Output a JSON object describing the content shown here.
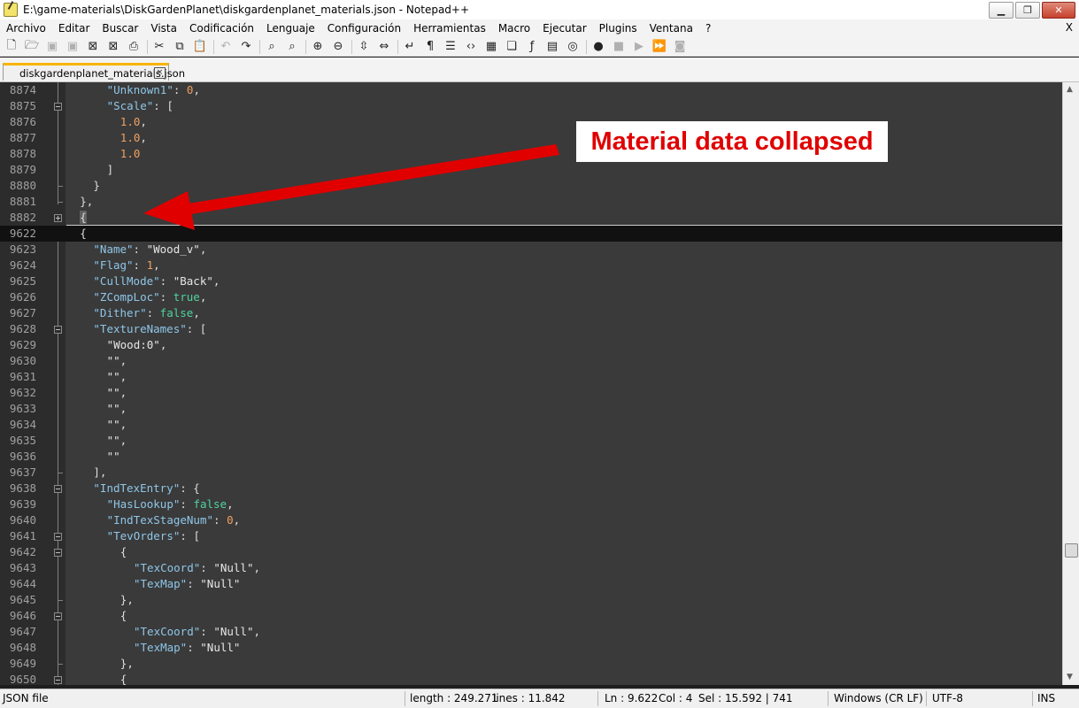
{
  "window": {
    "title": "E:\\game-materials\\DiskGardenPlanet\\diskgardenplanet_materials.json - Notepad++",
    "minimize": "▁",
    "maximize": "❐",
    "close": "✕"
  },
  "menu": {
    "items": [
      "Archivo",
      "Editar",
      "Buscar",
      "Vista",
      "Codificación",
      "Lenguaje",
      "Configuración",
      "Herramientas",
      "Macro",
      "Ejecutar",
      "Plugins",
      "Ventana",
      "?"
    ],
    "close_x": "X"
  },
  "toolbar": {
    "icons": [
      {
        "name": "new-file-icon",
        "glyph": "🗋",
        "disabled": false
      },
      {
        "name": "open-file-icon",
        "glyph": "🗁",
        "disabled": false
      },
      {
        "name": "save-icon",
        "glyph": "▣",
        "disabled": true
      },
      {
        "name": "save-all-icon",
        "glyph": "▣",
        "disabled": true
      },
      {
        "name": "close-file-icon",
        "glyph": "⊠",
        "disabled": false
      },
      {
        "name": "close-all-icon",
        "glyph": "⊠",
        "disabled": false
      },
      {
        "name": "print-icon",
        "glyph": "⎙",
        "disabled": false
      },
      {
        "sep": true
      },
      {
        "name": "cut-icon",
        "glyph": "✂",
        "disabled": false
      },
      {
        "name": "copy-icon",
        "glyph": "⧉",
        "disabled": false
      },
      {
        "name": "paste-icon",
        "glyph": "📋",
        "disabled": false
      },
      {
        "sep": true
      },
      {
        "name": "undo-icon",
        "glyph": "↶",
        "disabled": true
      },
      {
        "name": "redo-icon",
        "glyph": "↷",
        "disabled": false
      },
      {
        "sep": true
      },
      {
        "name": "find-icon",
        "glyph": "⌕",
        "disabled": false
      },
      {
        "name": "replace-icon",
        "glyph": "⌕",
        "disabled": false
      },
      {
        "sep": true
      },
      {
        "name": "zoom-in-icon",
        "glyph": "⊕",
        "disabled": false
      },
      {
        "name": "zoom-out-icon",
        "glyph": "⊖",
        "disabled": false
      },
      {
        "sep": true
      },
      {
        "name": "sync-vertical-icon",
        "glyph": "⇳",
        "disabled": false
      },
      {
        "name": "sync-horizontal-icon",
        "glyph": "⇔",
        "disabled": false
      },
      {
        "sep": true
      },
      {
        "name": "word-wrap-icon",
        "glyph": "↵",
        "disabled": false
      },
      {
        "name": "show-all-chars-icon",
        "glyph": "¶",
        "disabled": false
      },
      {
        "name": "indent-guide-icon",
        "glyph": "☰",
        "disabled": false
      },
      {
        "name": "xml-tag-icon",
        "glyph": "‹›",
        "disabled": false
      },
      {
        "name": "document-map-icon",
        "glyph": "▦",
        "disabled": false
      },
      {
        "name": "document-list-icon",
        "glyph": "❏",
        "disabled": false
      },
      {
        "name": "function-list-icon",
        "glyph": "ƒ",
        "disabled": false
      },
      {
        "name": "folder-workspace-icon",
        "glyph": "▤",
        "disabled": false
      },
      {
        "name": "monitoring-icon",
        "glyph": "◎",
        "disabled": false
      },
      {
        "sep": true
      },
      {
        "name": "record-macro-icon",
        "glyph": "●",
        "disabled": false
      },
      {
        "name": "stop-macro-icon",
        "glyph": "■",
        "disabled": true
      },
      {
        "name": "play-macro-icon",
        "glyph": "▶",
        "disabled": true
      },
      {
        "name": "run-macro-multiple-icon",
        "glyph": "⏩",
        "disabled": false
      },
      {
        "name": "save-macro-icon",
        "glyph": "◙",
        "disabled": true
      }
    ]
  },
  "tab": {
    "label": "diskgardenplanet_materials.json",
    "close": "×"
  },
  "editor": {
    "lines": [
      {
        "ln": "8874",
        "indent": 6,
        "tokens": [
          [
            "k",
            "\"Unknown1\""
          ],
          [
            "p",
            ": "
          ],
          [
            "n",
            "0"
          ],
          [
            "p",
            ","
          ]
        ]
      },
      {
        "ln": "8875",
        "indent": 6,
        "tokens": [
          [
            "k",
            "\"Scale\""
          ],
          [
            "p",
            ": ["
          ]
        ]
      },
      {
        "ln": "8876",
        "indent": 8,
        "tokens": [
          [
            "n",
            "1.0"
          ],
          [
            "p",
            ","
          ]
        ]
      },
      {
        "ln": "8877",
        "indent": 8,
        "tokens": [
          [
            "n",
            "1.0"
          ],
          [
            "p",
            ","
          ]
        ]
      },
      {
        "ln": "8878",
        "indent": 8,
        "tokens": [
          [
            "n",
            "1.0"
          ]
        ]
      },
      {
        "ln": "8879",
        "indent": 6,
        "tokens": [
          [
            "p",
            "]"
          ]
        ]
      },
      {
        "ln": "8880",
        "indent": 4,
        "tokens": [
          [
            "p",
            "}"
          ]
        ]
      },
      {
        "ln": "8881",
        "indent": 2,
        "tokens": [
          [
            "p",
            "},"
          ]
        ]
      },
      {
        "ln": "8882",
        "indent": 2,
        "tokens": [
          [
            "hl",
            "{"
          ]
        ]
      },
      {
        "ln": "9622",
        "indent": 2,
        "tokens": [
          [
            "p",
            "{"
          ]
        ],
        "current": true
      },
      {
        "ln": "9623",
        "indent": 4,
        "tokens": [
          [
            "k",
            "\"Name\""
          ],
          [
            "p",
            ": "
          ],
          [
            "s",
            "\"Wood_v\""
          ],
          [
            "p",
            ","
          ]
        ]
      },
      {
        "ln": "9624",
        "indent": 4,
        "tokens": [
          [
            "k",
            "\"Flag\""
          ],
          [
            "p",
            ": "
          ],
          [
            "n",
            "1"
          ],
          [
            "p",
            ","
          ]
        ]
      },
      {
        "ln": "9625",
        "indent": 4,
        "tokens": [
          [
            "k",
            "\"CullMode\""
          ],
          [
            "p",
            ": "
          ],
          [
            "s",
            "\"Back\""
          ],
          [
            "p",
            ","
          ]
        ]
      },
      {
        "ln": "9626",
        "indent": 4,
        "tokens": [
          [
            "k",
            "\"ZCompLoc\""
          ],
          [
            "p",
            ": "
          ],
          [
            "b",
            "true"
          ],
          [
            "p",
            ","
          ]
        ]
      },
      {
        "ln": "9627",
        "indent": 4,
        "tokens": [
          [
            "k",
            "\"Dither\""
          ],
          [
            "p",
            ": "
          ],
          [
            "b",
            "false"
          ],
          [
            "p",
            ","
          ]
        ]
      },
      {
        "ln": "9628",
        "indent": 4,
        "tokens": [
          [
            "k",
            "\"TextureNames\""
          ],
          [
            "p",
            ": ["
          ]
        ]
      },
      {
        "ln": "9629",
        "indent": 6,
        "tokens": [
          [
            "s",
            "\"Wood:0\""
          ],
          [
            "p",
            ","
          ]
        ]
      },
      {
        "ln": "9630",
        "indent": 6,
        "tokens": [
          [
            "s",
            "\"\""
          ],
          [
            "p",
            ","
          ]
        ]
      },
      {
        "ln": "9631",
        "indent": 6,
        "tokens": [
          [
            "s",
            "\"\""
          ],
          [
            "p",
            ","
          ]
        ]
      },
      {
        "ln": "9632",
        "indent": 6,
        "tokens": [
          [
            "s",
            "\"\""
          ],
          [
            "p",
            ","
          ]
        ]
      },
      {
        "ln": "9633",
        "indent": 6,
        "tokens": [
          [
            "s",
            "\"\""
          ],
          [
            "p",
            ","
          ]
        ]
      },
      {
        "ln": "9634",
        "indent": 6,
        "tokens": [
          [
            "s",
            "\"\""
          ],
          [
            "p",
            ","
          ]
        ]
      },
      {
        "ln": "9635",
        "indent": 6,
        "tokens": [
          [
            "s",
            "\"\""
          ],
          [
            "p",
            ","
          ]
        ]
      },
      {
        "ln": "9636",
        "indent": 6,
        "tokens": [
          [
            "s",
            "\"\""
          ]
        ]
      },
      {
        "ln": "9637",
        "indent": 4,
        "tokens": [
          [
            "p",
            "],"
          ]
        ]
      },
      {
        "ln": "9638",
        "indent": 4,
        "tokens": [
          [
            "k",
            "\"IndTexEntry\""
          ],
          [
            "p",
            ": {"
          ]
        ]
      },
      {
        "ln": "9639",
        "indent": 6,
        "tokens": [
          [
            "k",
            "\"HasLookup\""
          ],
          [
            "p",
            ": "
          ],
          [
            "b",
            "false"
          ],
          [
            "p",
            ","
          ]
        ]
      },
      {
        "ln": "9640",
        "indent": 6,
        "tokens": [
          [
            "k",
            "\"IndTexStageNum\""
          ],
          [
            "p",
            ": "
          ],
          [
            "n",
            "0"
          ],
          [
            "p",
            ","
          ]
        ]
      },
      {
        "ln": "9641",
        "indent": 6,
        "tokens": [
          [
            "k",
            "\"TevOrders\""
          ],
          [
            "p",
            ": ["
          ]
        ]
      },
      {
        "ln": "9642",
        "indent": 8,
        "tokens": [
          [
            "p",
            "{"
          ]
        ]
      },
      {
        "ln": "9643",
        "indent": 10,
        "tokens": [
          [
            "k",
            "\"TexCoord\""
          ],
          [
            "p",
            ": "
          ],
          [
            "s",
            "\"Null\""
          ],
          [
            "p",
            ","
          ]
        ]
      },
      {
        "ln": "9644",
        "indent": 10,
        "tokens": [
          [
            "k",
            "\"TexMap\""
          ],
          [
            "p",
            ": "
          ],
          [
            "s",
            "\"Null\""
          ]
        ]
      },
      {
        "ln": "9645",
        "indent": 8,
        "tokens": [
          [
            "p",
            "},"
          ]
        ]
      },
      {
        "ln": "9646",
        "indent": 8,
        "tokens": [
          [
            "p",
            "{"
          ]
        ]
      },
      {
        "ln": "9647",
        "indent": 10,
        "tokens": [
          [
            "k",
            "\"TexCoord\""
          ],
          [
            "p",
            ": "
          ],
          [
            "s",
            "\"Null\""
          ],
          [
            "p",
            ","
          ]
        ]
      },
      {
        "ln": "9648",
        "indent": 10,
        "tokens": [
          [
            "k",
            "\"TexMap\""
          ],
          [
            "p",
            ": "
          ],
          [
            "s",
            "\"Null\""
          ]
        ]
      },
      {
        "ln": "9649",
        "indent": 8,
        "tokens": [
          [
            "p",
            "},"
          ]
        ]
      },
      {
        "ln": "9650",
        "indent": 8,
        "tokens": [
          [
            "p",
            "{"
          ]
        ]
      }
    ]
  },
  "annotation": {
    "label": "Material data collapsed",
    "color": "#e00000"
  },
  "status": {
    "file_type": "JSON file",
    "length": "length : 249.271",
    "lines": "lines : 11.842",
    "ln": "Ln : 9.622",
    "col": "Col : 4",
    "sel": "Sel : 15.592 | 741",
    "eol": "Windows (CR LF)",
    "encoding": "UTF-8",
    "mode": "INS"
  },
  "colors": {
    "key": "#8ec6e8",
    "string": "#e6e6e6",
    "number": "#f0a060",
    "boolean": "#4fd4a0",
    "editor_bg": "#3a3a3a",
    "tab_accent": "#f7b500"
  }
}
